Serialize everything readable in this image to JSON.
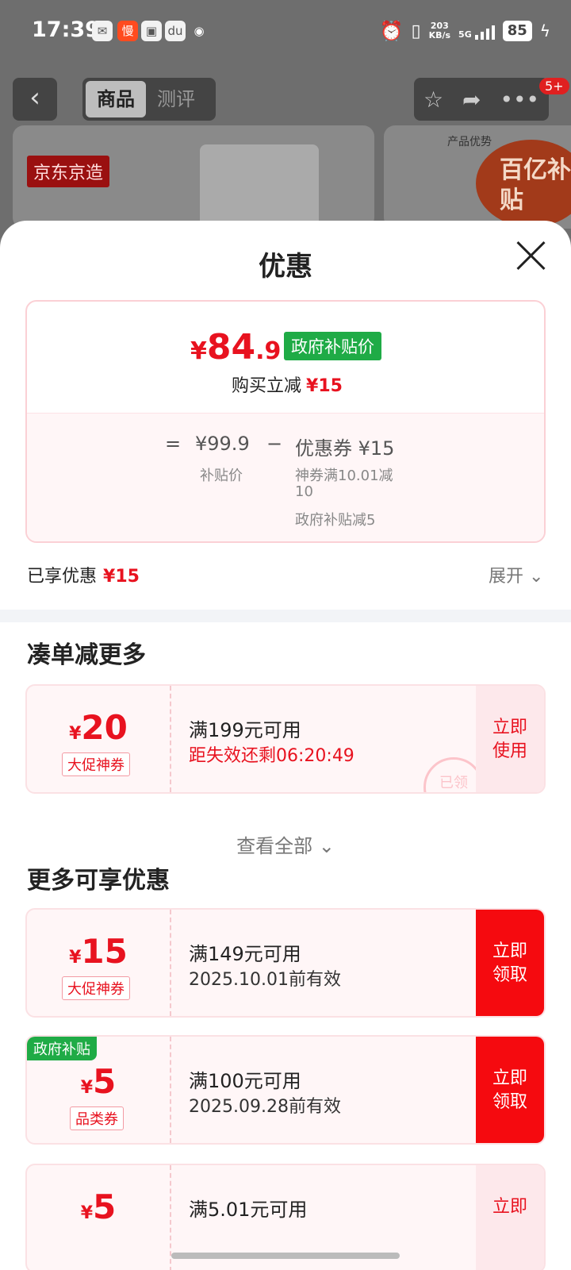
{
  "status_bar": {
    "time": "17:39",
    "net_speed": "203",
    "net_unit": "KB/s",
    "signal": "5G",
    "battery": "85"
  },
  "nav": {
    "back_icon": "chevron-left-icon",
    "tabs": [
      "商品",
      "测评"
    ],
    "badge": "5+"
  },
  "product_cards": {
    "brand_tag": "京东京造",
    "card2_title": "产品优势",
    "subsidy_badge": "百亿补贴"
  },
  "sheet": {
    "title": "优惠"
  },
  "price_box": {
    "currency": "¥",
    "price_int": "84",
    "price_dec": ".9",
    "gov_tag": "政府补贴价",
    "cut_label": "购买立减",
    "cut_value": "¥15",
    "eq": "=",
    "subsidy_price": "¥99.9",
    "subsidy_price_label": "补贴价",
    "minus": "−",
    "coupon_label": "优惠券 ¥15",
    "detail1": "神券满10.01减",
    "detail1b": "10",
    "detail2": "政府补贴减5"
  },
  "enjoyed": {
    "label": "已享优惠",
    "value": "¥15",
    "expand": "展开"
  },
  "section1": {
    "title": "凑单减更多"
  },
  "coupon1": {
    "currency": "¥",
    "value": "20",
    "type": "大促神券",
    "condition": "满199元可用",
    "expiry": "距失效还剩06:20:49",
    "button_l1": "立即",
    "button_l2": "使用",
    "stamp": "已领"
  },
  "view_all": "查看全部",
  "section2": {
    "title": "更多可享优惠"
  },
  "coupon2": {
    "currency": "¥",
    "value": "15",
    "type": "大促神券",
    "condition": "满149元可用",
    "expiry": "2025.10.01前有效",
    "button_l1": "立即",
    "button_l2": "领取"
  },
  "coupon3": {
    "corner": "政府补贴",
    "currency": "¥",
    "value": "5",
    "type": "品类券",
    "condition": "满100元可用",
    "expiry": "2025.09.28前有效",
    "button_l1": "立即",
    "button_l2": "领取"
  },
  "coupon4": {
    "currency": "¥",
    "value": "5",
    "condition": "满5.01元可用",
    "button_l1": "立即"
  },
  "colors": {
    "accent": "#e8121f",
    "gov_green": "#1fab46",
    "button_red": "#f50a0f"
  }
}
